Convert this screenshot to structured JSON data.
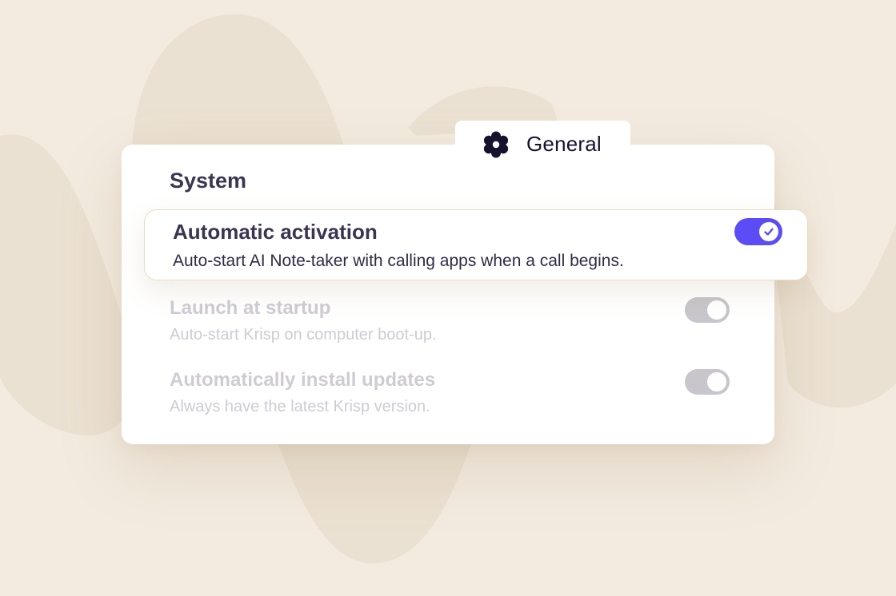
{
  "colors": {
    "background": "#f3ebe0",
    "accent": "#5b4cf5",
    "text_primary": "#3b3550",
    "text_disabled": "#cfcbd3"
  },
  "tab": {
    "label": "General",
    "icon": "gear-icon"
  },
  "section": {
    "title": "System"
  },
  "settings": [
    {
      "title": "Automatic activation",
      "description": "Auto-start AI Note-taker with calling apps when a call begins.",
      "enabled": true,
      "state": "active"
    },
    {
      "title": "Launch at startup",
      "description": "Auto-start Krisp on computer boot-up.",
      "enabled": true,
      "state": "disabled"
    },
    {
      "title": "Automatically install updates",
      "description": "Always have the latest Krisp version.",
      "enabled": true,
      "state": "disabled"
    }
  ]
}
